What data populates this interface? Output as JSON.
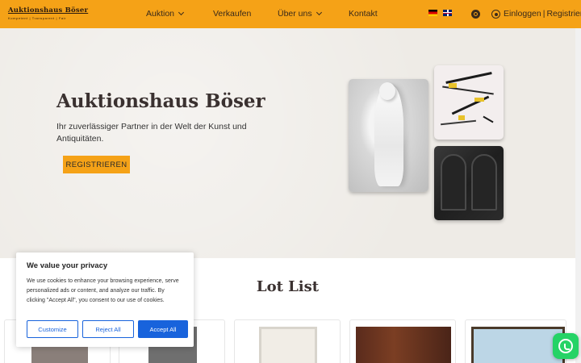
{
  "header": {
    "logo_title": "Auktionshaus Böser",
    "logo_subtitle": "Kompetent | Transparent | Fair",
    "nav": [
      {
        "label": "Auktion"
      },
      {
        "label": "Verkaufen"
      },
      {
        "label": "Über uns"
      },
      {
        "label": "Kontakt"
      }
    ],
    "languages": [
      "de-flag-icon",
      "gb-flag-icon"
    ],
    "login_label": "Einloggen",
    "separator": "|",
    "register_label": "Registrieren"
  },
  "hero": {
    "title": "Auktionshaus Böser",
    "subtitle": "Ihr zuverlässiger Partner in der Welt der Kunst und Antiquitäten.",
    "cta_label": "REGISTRIEREN"
  },
  "lots": {
    "heading": "Lot List",
    "colors": [
      "#8a7f7a",
      "#6f6f6f",
      "#f1ede6",
      "#5a2b1c",
      "#bcd6e6"
    ]
  },
  "cookie": {
    "title": "We value your privacy",
    "text": "We use cookies to enhance your browsing experience, serve personalized ads or content, and analyze our traffic. By clicking \"Accept All\", you consent to our use of cookies.",
    "customize_label": "Customize",
    "reject_label": "Reject All",
    "accept_label": "Accept All"
  },
  "theme": {
    "accent": "#f5a217",
    "cookie_blue": "#1863dc",
    "whatsapp_green": "#25d366"
  }
}
